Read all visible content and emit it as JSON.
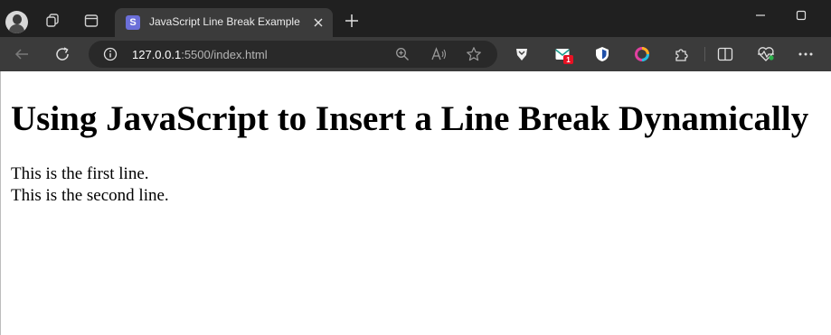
{
  "tab": {
    "title": "JavaScript Line Break Example",
    "favicon_letter": "S"
  },
  "address_bar": {
    "url_host": "127.0.0.1",
    "url_rest": ":5500/index.html"
  },
  "extensions": {
    "mail_badge": "1"
  },
  "page": {
    "heading": "Using JavaScript to Insert a Line Break Dynamically",
    "line1": "This is the first line.",
    "line2": "This is the second line."
  },
  "icons": [
    "profile-avatar",
    "workspaces-icon",
    "tab-actions-icon",
    "close-icon",
    "plus-icon",
    "minimize-icon",
    "maximize-icon",
    "back-arrow-icon",
    "refresh-icon",
    "info-icon",
    "zoom-icon",
    "read-aloud-icon",
    "star-icon",
    "brave-icon",
    "mail-icon",
    "shield-icon",
    "color-ring-icon",
    "puzzle-icon",
    "split-screen-icon",
    "health-icon",
    "more-icon"
  ],
  "colors": {
    "tabstrip": "#202020",
    "toolbar": "#3b3b3b",
    "addressbar": "#292929",
    "favicon": "#6b6fd9",
    "badge": "#e81123"
  }
}
